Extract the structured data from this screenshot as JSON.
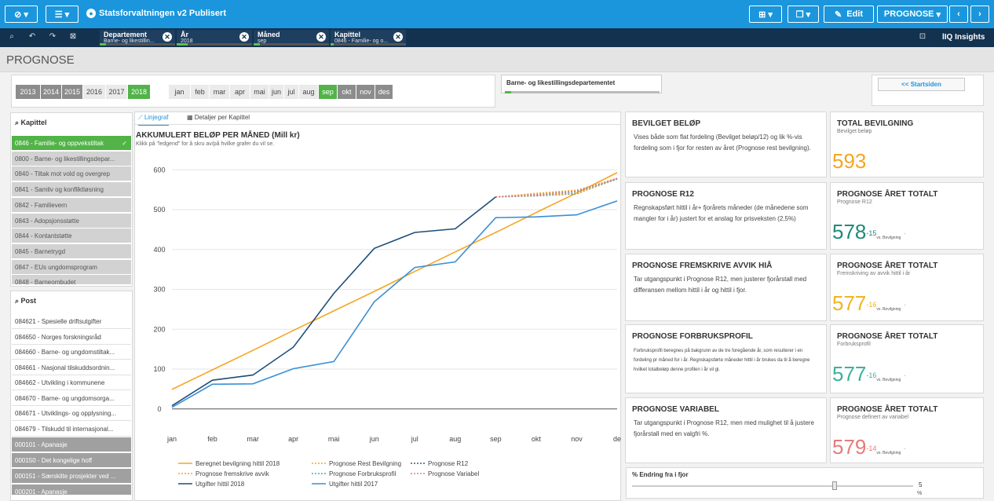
{
  "app": {
    "title": "Statsforvaltningen v2 Publisert",
    "edit_label": "Edit",
    "sheet_label": "PROGNOSE",
    "insights_label": "Insights"
  },
  "filters": [
    {
      "title": "Departement",
      "value": "Barne- og likestillin..."
    },
    {
      "title": "År",
      "value": "2018"
    },
    {
      "title": "Måned",
      "value": "sep"
    },
    {
      "title": "Kapittel",
      "value": "0846 - Familie- og o..."
    }
  ],
  "page_title": "PROGNOSE",
  "years": [
    "2013",
    "2014",
    "2015",
    "2016",
    "2017",
    "2018"
  ],
  "selected_year": "2018",
  "months": [
    "jan",
    "feb",
    "mar",
    "apr",
    "mai",
    "jun",
    "jul",
    "aug",
    "sep",
    "okt",
    "nov",
    "des"
  ],
  "selected_month": "sep",
  "department_label": "Barne- og likestillingsdepartementet",
  "start_button": "<< Startsiden",
  "kapittel": {
    "header": "Kapittel",
    "items": [
      "0846 - Familie- og oppvekstiltak",
      "0800 - Barne- og likestillingsdepar...",
      "0840 - Tiltak mot vold og overgrep",
      "0841 - Samliv og konfliktløsning",
      "0842 - Familievern",
      "0843 - Adopsjonsstøtte",
      "0844 - Kontantstøtte",
      "0845 - Barnetrygd",
      "0847 - EUs ungdomsprogram",
      "0848 - Barneombudet"
    ]
  },
  "post": {
    "header": "Post",
    "items": [
      "084621 - Spesielle driftsutgifter",
      "084650 - Norges forskningsråd",
      "084660 - Barne- og ungdomstiltak...",
      "084661 - Nasjonal tilskuddsordnin...",
      "084662 - Utvikling i kommunene",
      "084670 - Barne- og ungdomsorga...",
      "084671 - Utviklings- og opplysning...",
      "084679 - Tilskudd til internasjonal..."
    ],
    "excluded": [
      "000101 - Apanasje",
      "000150 - Det kongelige hoff",
      "000151 - Særskilte prosjekter ved ...",
      "000201 - Apanasje"
    ]
  },
  "tabs": [
    "Linjegraf",
    "Detaljer per Kapittel"
  ],
  "chart_data": {
    "type": "line",
    "title": "AKKUMULERT BELØP PER MÅNED (Mill kr)",
    "subtitle": "Klikk på \"ledgend\" for å skru av/på hvilke grafer du vil se.",
    "categories": [
      "jan",
      "feb",
      "mar",
      "apr",
      "mai",
      "jun",
      "jul",
      "aug",
      "sep",
      "okt",
      "nov",
      "de"
    ],
    "yticks": [
      0,
      100,
      200,
      300,
      400,
      500,
      600
    ],
    "ylim": [
      -30,
      640
    ],
    "grid": true,
    "legend_position": "bottom",
    "series": [
      {
        "name": "Beregnet bevilgning hittil 2018",
        "color": "#f5a623",
        "dash": false,
        "values": [
          49,
          98,
          147,
          197,
          246,
          295,
          345,
          394,
          443,
          493,
          542,
          593
        ]
      },
      {
        "name": "Prognose Rest Bevilgning",
        "color": "#f5a623",
        "dash": true,
        "values": [
          null,
          null,
          null,
          null,
          null,
          null,
          null,
          null,
          532,
          541,
          549,
          578
        ]
      },
      {
        "name": "Prognose R12",
        "color": "#2a5f8c",
        "dash": true,
        "values": [
          null,
          null,
          null,
          null,
          null,
          null,
          null,
          null,
          532,
          535,
          540,
          578
        ]
      },
      {
        "name": "Prognose fremskrive avvik",
        "color": "#f5a623",
        "dash": true,
        "values": [
          null,
          null,
          null,
          null,
          null,
          null,
          null,
          null,
          532,
          536,
          541,
          577
        ]
      },
      {
        "name": "Prognose Forbruksprofil",
        "color": "#3bb0c9",
        "dash": true,
        "values": [
          null,
          null,
          null,
          null,
          null,
          null,
          null,
          null,
          532,
          537,
          545,
          577
        ]
      },
      {
        "name": "Prognose Variabel",
        "color": "#e87a7a",
        "dash": true,
        "values": [
          null,
          null,
          null,
          null,
          null,
          null,
          null,
          null,
          532,
          538,
          547,
          579
        ]
      },
      {
        "name": "Utgifter hittil 2018",
        "color": "#1f4e79",
        "dash": false,
        "values": [
          8,
          72,
          85,
          155,
          290,
          403,
          443,
          452,
          532,
          null,
          null,
          null
        ]
      },
      {
        "name": "Utgifter hittil 2017",
        "color": "#3a8fd6",
        "dash": false,
        "values": [
          4,
          62,
          63,
          101,
          119,
          269,
          355,
          369,
          480,
          482,
          487,
          522
        ]
      }
    ]
  },
  "cards": [
    {
      "title": "BEVILGET BELØP",
      "text": "Vises både som flat fordeling (Bevilget beløp/12) og lik %-vis fordeling som i fjor for resten av året (Prognose rest bevilgning)."
    },
    {
      "title": "PROGNOSE R12",
      "text": "Regnskapsført hittil i år+ fjorårets måneder (de månedene som mangler for i år) justert for et anslag for prisveksten (2,5%)"
    },
    {
      "title": "PROGNOSE FREMSKRIVE AVVIK HIÅ",
      "text": "Tar utgangspunkt i Prognose R12, men justerer fjorårstall med differansen mellom hittil i år og hittil i fjor."
    },
    {
      "title": "PROGNOSE FORBRUKSPROFIL",
      "text": "Forbruksprofil beregnes på bakgrunn av de tre foregående år, som resulterer i en fordeling pr måned for i år. Regnskapsførte måneder hittil i år brukes da til å beregne hvilket totalbeløp denne profilen i år vil gi."
    },
    {
      "title": "PROGNOSE VARIABEL",
      "text": "Tar utgangspunkt i Prognose R12, men med mulighet til å justere fjorårstall med en valgfri %."
    }
  ],
  "kpis": [
    {
      "title": "TOTAL BEVILGNING",
      "subtitle": "Bevilget beløp",
      "value": "593",
      "delta": "",
      "vs": "",
      "color": "#f5a623"
    },
    {
      "title": "PROGNOSE ÅRET TOTALT",
      "subtitle": "Prognose R12",
      "value": "578",
      "delta": "-15",
      "vs": "vs. Bevilgning",
      "color": "#1f8a78"
    },
    {
      "title": "PROGNOSE ÅRET TOTALT",
      "subtitle": "Fremskriving av avvik hittil i år",
      "value": "577",
      "delta": "-16",
      "vs": "vs. Bevilgning",
      "color": "#f0b41e"
    },
    {
      "title": "PROGNOSE ÅRET TOTALT",
      "subtitle": "Forbruksprofil",
      "value": "577",
      "delta": "-16",
      "vs": "vs. Bevilgning",
      "color": "#3bb0a0"
    },
    {
      "title": "PROGNOSE ÅRET TOTALT",
      "subtitle": "Prognose definert av variabel",
      "value": "579",
      "delta": "-14",
      "vs": "vs. Bevilgning",
      "color": "#e87a7a"
    }
  ],
  "slider": {
    "label": "% Endring fra i fjor",
    "value": "5",
    "unit": "%",
    "position": 0.72
  }
}
